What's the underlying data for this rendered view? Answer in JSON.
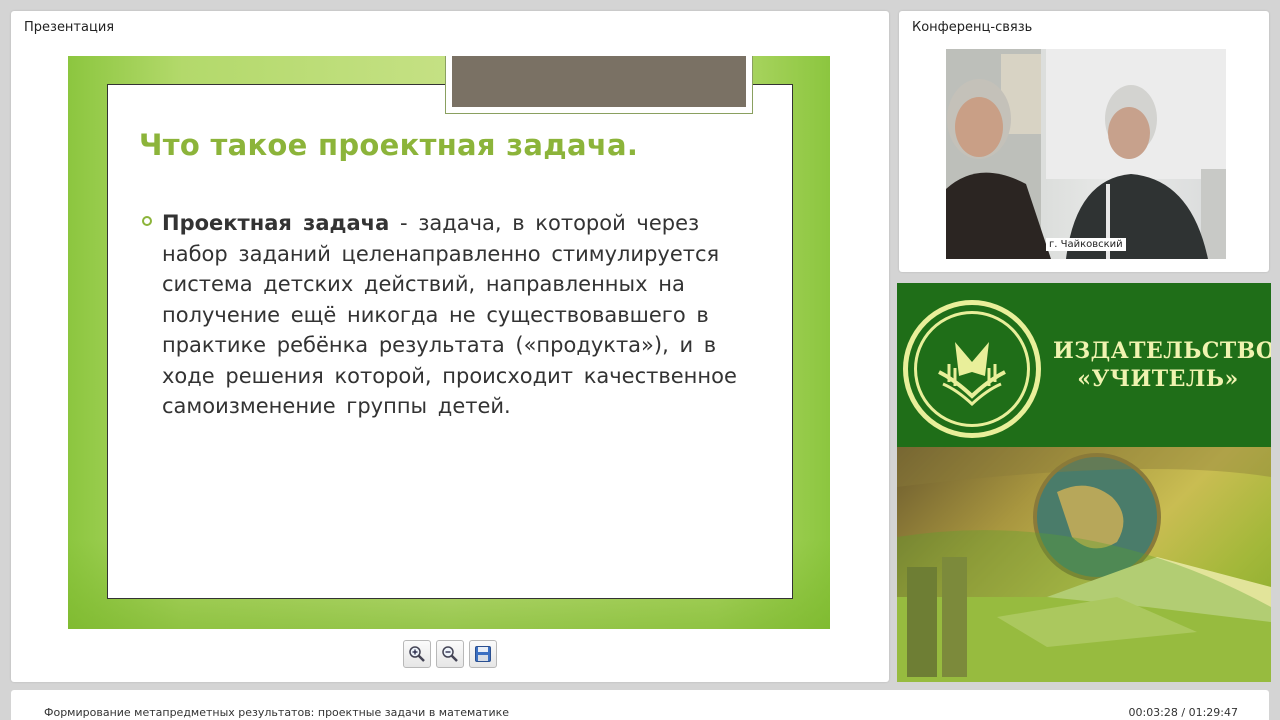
{
  "presentation": {
    "title": "Презентация",
    "slide": {
      "heading": "Что такое проектная задача.",
      "term": "Проектная задача",
      "definition": " - задача, в которой через набор заданий целенаправленно стимулируется система детских действий, направленных на получение ещё никогда не существовавшего в практике ребёнка результата («продукта»), и в ходе решения которой, происходит качественное самоизменение группы детей."
    },
    "toolbar": {
      "zoom_in_icon": "zoom-in-icon",
      "zoom_out_icon": "zoom-out-icon",
      "save_icon": "save-icon"
    }
  },
  "conference": {
    "title": "Конференц-связь",
    "video_label": "г. Чайковский"
  },
  "ad": {
    "line1": "ИЗДАТЕЛЬСТВО",
    "line2": "«УЧИТЕЛЬ»"
  },
  "footer": {
    "title": "Формирование метапредметных результатов: проектные задачи в математике",
    "time": "00:03:28 / 01:29:47"
  },
  "colors": {
    "accent_green": "#8cb43a",
    "ad_green": "#1f6e18"
  }
}
